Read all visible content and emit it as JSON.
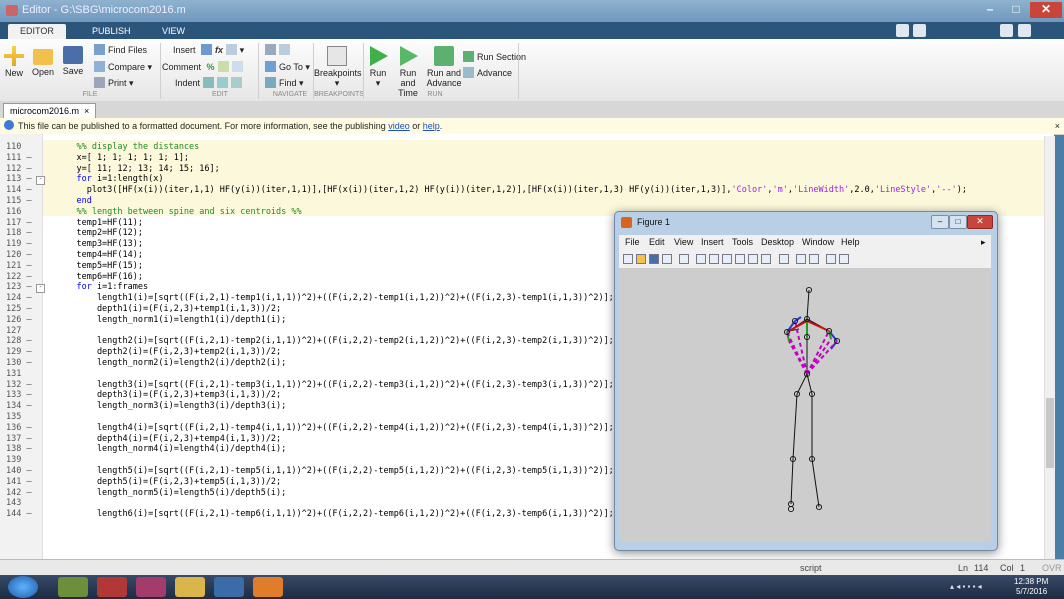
{
  "window": {
    "title": "Editor - G:\\SBG\\microcom2016.m"
  },
  "tabs": [
    "EDITOR",
    "PUBLISH",
    "VIEW"
  ],
  "ribbon": {
    "file": {
      "new": "New",
      "open": "Open",
      "save": "Save",
      "find_files": "Find Files",
      "compare": "Compare",
      "print": "Print",
      "group": "FILE"
    },
    "edit": {
      "insert": "Insert",
      "comment": "Comment",
      "indent": "Indent",
      "group": "EDIT"
    },
    "navigate": {
      "goto": "Go To",
      "find": "Find",
      "group": "NAVIGATE"
    },
    "breakpoints": {
      "label": "Breakpoints",
      "group": "BREAKPOINTS"
    },
    "run": {
      "run": "Run",
      "run_and": "Run and",
      "time": "Time",
      "run_and2": "Run and",
      "advance": "Advance",
      "run_section": "Run Section",
      "advance2": "Advance",
      "group": "RUN"
    }
  },
  "file_tab": {
    "name": "microcom2016.m"
  },
  "info_bar": {
    "text": "This file can be published to a formatted document. For more information, see the publishing",
    "video": "video",
    "or": "or",
    "help": "help",
    "period": "."
  },
  "lines": [
    {
      "n": "110",
      "t": "    %% display the distances"
    },
    {
      "n": "111 –",
      "t": "    x=[ 1; 1; 1; 1; 1; 1];"
    },
    {
      "n": "112 –",
      "t": "    y=[ 11; 12; 13; 14; 15; 16];"
    },
    {
      "n": "113 –",
      "t": "    for i=1:length(x)"
    },
    {
      "n": "114 –",
      "t": "      plot3([HF(x(i))(iter,1,1) HF(y(i))(iter,1,1)],[HF(x(i))(iter,1,2) HF(y(i))(iter,1,2)],[HF(x(i))(iter,1,3) HF(y(i))(iter,1,3)],'Color','m','LineWidth',2.0,'LineStyle','--');"
    },
    {
      "n": "115 –",
      "t": "    end"
    },
    {
      "n": "116",
      "t": "    %% length between spine and six centroids %%"
    },
    {
      "n": "117 –",
      "t": "    temp1=HF(11);"
    },
    {
      "n": "118 –",
      "t": "    temp2=HF(12);"
    },
    {
      "n": "119 –",
      "t": "    temp3=HF(13);"
    },
    {
      "n": "120 –",
      "t": "    temp4=HF(14);"
    },
    {
      "n": "121 –",
      "t": "    temp5=HF(15);"
    },
    {
      "n": "122 –",
      "t": "    temp6=HF(16);"
    },
    {
      "n": "123 –",
      "t": "    for i=1:frames"
    },
    {
      "n": "124 –",
      "t": "        length1(i)=[sqrt((F(i,2,1)-temp1(i,1,1))^2)+((F(i,2,2)-temp1(i,1,2))^2)+((F(i,2,3)-temp1(i,1,3))^2)];"
    },
    {
      "n": "125 –",
      "t": "        depth1(i)=(F(i,2,3)+temp1(i,1,3))/2;"
    },
    {
      "n": "126 –",
      "t": "        length_norm1(i)=length1(i)/depth1(i);"
    },
    {
      "n": "127",
      "t": ""
    },
    {
      "n": "128 –",
      "t": "        length2(i)=[sqrt((F(i,2,1)-temp2(i,1,1))^2)+((F(i,2,2)-temp2(i,1,2))^2)+((F(i,2,3)-temp2(i,1,3))^2)];"
    },
    {
      "n": "129 –",
      "t": "        depth2(i)=(F(i,2,3)+temp2(i,1,3))/2;"
    },
    {
      "n": "130 –",
      "t": "        length_norm2(i)=length2(i)/depth2(i);"
    },
    {
      "n": "131",
      "t": ""
    },
    {
      "n": "132 –",
      "t": "        length3(i)=[sqrt((F(i,2,1)-temp3(i,1,1))^2)+((F(i,2,2)-temp3(i,1,2))^2)+((F(i,2,3)-temp3(i,1,3))^2)];"
    },
    {
      "n": "133 –",
      "t": "        depth3(i)=(F(i,2,3)+temp3(i,1,3))/2;"
    },
    {
      "n": "134 –",
      "t": "        length_norm3(i)=length3(i)/depth3(i);"
    },
    {
      "n": "135",
      "t": ""
    },
    {
      "n": "136 –",
      "t": "        length4(i)=[sqrt((F(i,2,1)-temp4(i,1,1))^2)+((F(i,2,2)-temp4(i,1,2))^2)+((F(i,2,3)-temp4(i,1,3))^2)];"
    },
    {
      "n": "137 –",
      "t": "        depth4(i)=(F(i,2,3)+temp4(i,1,3))/2;"
    },
    {
      "n": "138 –",
      "t": "        length_norm4(i)=length4(i)/depth4(i);"
    },
    {
      "n": "139",
      "t": ""
    },
    {
      "n": "140 –",
      "t": "        length5(i)=[sqrt((F(i,2,1)-temp5(i,1,1))^2)+((F(i,2,2)-temp5(i,1,2))^2)+((F(i,2,3)-temp5(i,1,3))^2)];"
    },
    {
      "n": "141 –",
      "t": "        depth5(i)=(F(i,2,3)+temp5(i,1,3))/2;"
    },
    {
      "n": "142 –",
      "t": "        length_norm5(i)=length5(i)/depth5(i);"
    },
    {
      "n": "143",
      "t": ""
    },
    {
      "n": "144 –",
      "t": "        length6(i)=[sqrt((F(i,2,1)-temp6(i,1,1))^2)+((F(i,2,2)-temp6(i,1,2))^2)+((F(i,2,3)-temp6(i,1,3))^2)];"
    }
  ],
  "figure": {
    "title": "Figure 1",
    "menu": [
      "File",
      "Edit",
      "View",
      "Insert",
      "Tools",
      "Desktop",
      "Window",
      "Help"
    ]
  },
  "status": {
    "mode": "script",
    "ln_label": "Ln",
    "ln": "114",
    "col_label": "Col",
    "col": "1",
    "ovr": "OVR"
  },
  "taskbar": {
    "time": "12:38 PM",
    "date": "5/7/2016"
  },
  "colors": {
    "ribbon_blue": "#2b557a",
    "magenta": "#c000c0",
    "comment": "#228b22",
    "string": "#a020f0"
  }
}
